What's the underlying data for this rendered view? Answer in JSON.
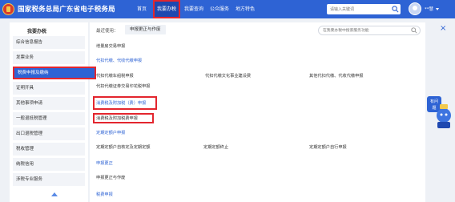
{
  "header": {
    "site_title": "国家税务总局广东省电子税务局",
    "nav": [
      {
        "label": "首页",
        "active": false
      },
      {
        "label": "我要办税",
        "active": true
      },
      {
        "label": "我要查询",
        "active": false
      },
      {
        "label": "公众服务",
        "active": false
      },
      {
        "label": "地方特色",
        "active": false
      }
    ],
    "search_placeholder": "请输入关键词",
    "username": "**慧",
    "icons": [
      "search-icon",
      "avatar-icon",
      "chevron-down-icon"
    ]
  },
  "sidebar": {
    "title": "我要办税",
    "items": [
      {
        "label": "综合信息报告"
      },
      {
        "label": "发票业务"
      },
      {
        "label": "税费申报及缴纳",
        "active": true
      },
      {
        "label": "证明开具"
      },
      {
        "label": "其他事项申请"
      },
      {
        "label": "一般退抵税管理"
      },
      {
        "label": "出口退税管理"
      },
      {
        "label": "税收管理"
      },
      {
        "label": "纳税信用"
      },
      {
        "label": "涉税专业服务"
      }
    ]
  },
  "main": {
    "recent_label": "最近使用：",
    "recent_items": [
      "申报更正与作废"
    ],
    "search_placeholder": "在我要办税中搜索服务功能",
    "vat_item": "增量房交易申报",
    "sections": {
      "proxy": {
        "title": "代扣代缴、代收代缴申报",
        "items": [
          "代扣代缴车船税申报",
          "代扣代缴文化事业建设费",
          "其他代扣代缴、代收代缴申报",
          "代扣代缴证券交易印花税申报"
        ]
      },
      "consumption": {
        "title": "消费税及附加税（费）申报",
        "items": [
          "消费税及附加税费申报"
        ]
      },
      "fixed": {
        "title": "定期定额户申报",
        "items": [
          "定期定额户自核定及定期定额",
          "定期定额终止",
          "定期定额户自行申报"
        ]
      },
      "correction": {
        "title": "申报更正",
        "items": [
          "申报更正与作废"
        ]
      },
      "more": {
        "title": "税费申报"
      }
    }
  },
  "widgets": {
    "bot_label": "有问题，问我"
  },
  "colors": {
    "primary": "#2e63d4",
    "highlight": "#e3262e",
    "background": "#eef1f6"
  }
}
